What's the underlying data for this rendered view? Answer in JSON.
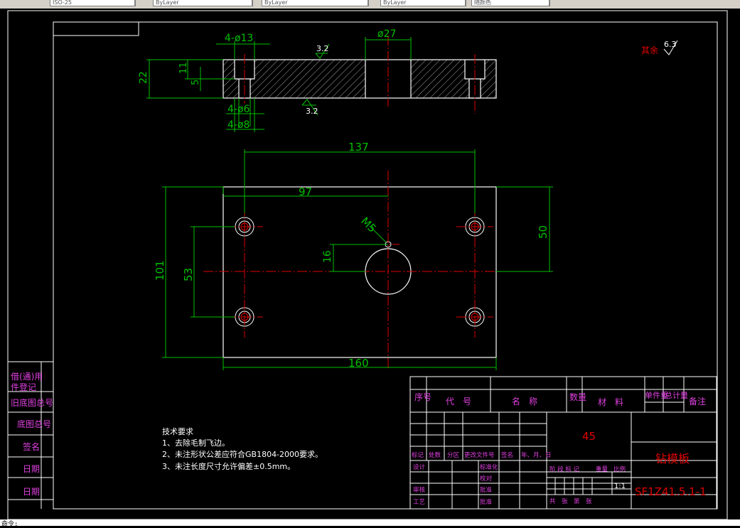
{
  "toolbar": {
    "fields": [
      "ISO-25",
      "ByLayer",
      "ByLayer",
      "ByLayer",
      "随颜色"
    ]
  },
  "dims": {
    "holes_13": "4-ø13",
    "dia_27": "ø27",
    "thick_22": "22",
    "cb_11": "11",
    "hole_5": "5",
    "holes_6": "4-ø6",
    "holes_8": "4-ø8",
    "rough_top": "3.2",
    "rough_bottom": "3.2",
    "rough_rest_label": "其余",
    "rough_rest_value": "6.3",
    "width_137": "137",
    "width_97": "97",
    "thread_m5": "M5",
    "dim_16": "16",
    "height_53": "53",
    "height_101": "101",
    "height_50": "50",
    "width_160": "160"
  },
  "side_labels": [
    "借(通)用",
    "件登记",
    "旧底图总号",
    "底图总号",
    "签名",
    "日期",
    "日期"
  ],
  "tech": {
    "title": "技术要求",
    "items": [
      "1、去除毛制飞边。",
      "2、未注形状公差应符合GB1804-2000要求。",
      "3、未注长度尺寸允许偏差±0.5mm。"
    ]
  },
  "title_block": {
    "col_no": "序号",
    "col_code": "代　号",
    "col_name": "名　称",
    "col_qty": "数量",
    "col_material": "材　料",
    "col_unit_weight": "单件重",
    "col_total": "总计量",
    "col_remark": "备注",
    "material_value": "45",
    "part_name": "钻模板",
    "drawing_no": "SF1Z41.5.1-1",
    "rev_row": [
      "标记",
      "处数",
      "分区",
      "更改文件号",
      "签名",
      "年、月、日"
    ],
    "design": "设计",
    "standardize": "标准化",
    "review": "审核",
    "process": "工艺",
    "check": "校对",
    "approve": "批准",
    "stage_row": [
      "阶 段 标 记",
      "重量",
      "比例"
    ],
    "scale": "1:1",
    "sheets": "共　张　第　张"
  },
  "cmdline": "命令:"
}
